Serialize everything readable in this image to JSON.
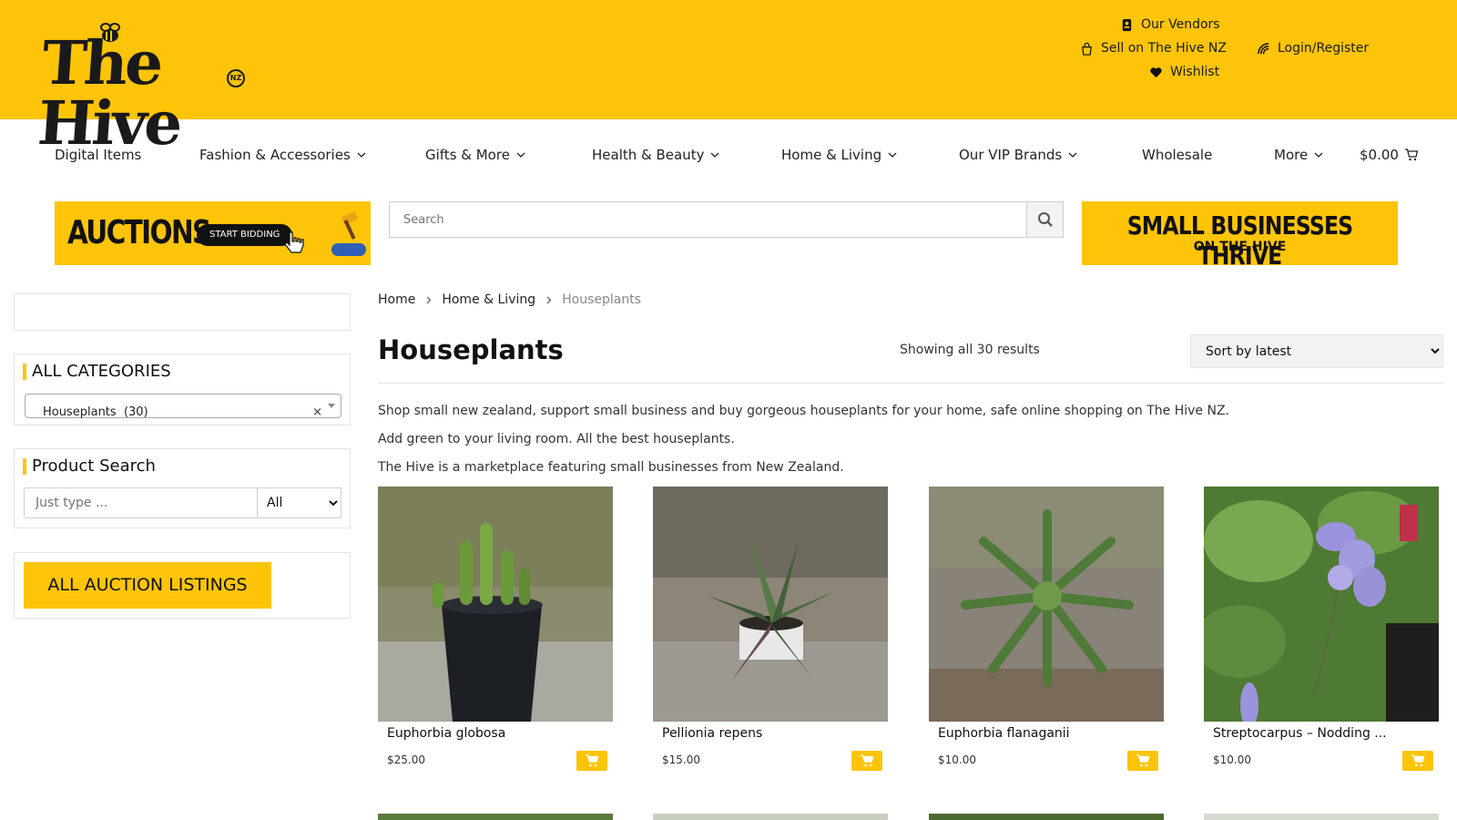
{
  "header": {
    "logo_text": "The Hive",
    "logo_badge": "NZ",
    "links": {
      "vendors": "Our Vendors",
      "sell": "Sell on The Hive NZ",
      "wishlist": "Wishlist",
      "login": "Login/Register"
    }
  },
  "nav": {
    "items": [
      {
        "label": "Digital Items"
      },
      {
        "label": "Fashion & Accessories"
      },
      {
        "label": "Gifts & More"
      },
      {
        "label": "Health & Beauty"
      },
      {
        "label": "Home & Living"
      },
      {
        "label": "Our VIP Brands"
      },
      {
        "label": "Wholesale"
      },
      {
        "label": "More"
      }
    ],
    "cart_total": "$0.00"
  },
  "banners": {
    "auctions": {
      "headline": "AUCTIONS",
      "button": "START BIDDING",
      "badge": "AUCTIONS"
    },
    "thrive": {
      "line1": "SMALL BUSINESSES THRIVE",
      "line2": "ON THE HIVE"
    }
  },
  "search": {
    "placeholder": "Search"
  },
  "sidebar": {
    "categories_title": "ALL CATEGORIES",
    "category_value": "Houseplants  (30)",
    "category_clear": "×",
    "product_search_title": "Product Search",
    "product_search_placeholder": "Just type ...",
    "product_search_scope": "All",
    "auction_button": "ALL AUCTION LISTINGS"
  },
  "breadcrumb": {
    "home": "Home",
    "parent": "Home & Living",
    "current": "Houseplants"
  },
  "listing": {
    "title": "Houseplants",
    "results": "Showing all 30 results",
    "sort": "Sort by latest",
    "description": [
      "Shop small new zealand, support small business and buy gorgeous houseplants for your home, safe online shopping on The Hive NZ.",
      "Add green to your living room. All the best houseplants.",
      "The Hive is a marketplace featuring small businesses from New Zealand."
    ],
    "products": [
      {
        "name": "Euphorbia globosa",
        "price": "$25.00"
      },
      {
        "name": "Pellionia repens",
        "price": "$15.00"
      },
      {
        "name": "Euphorbia flanaganii",
        "price": "$10.00"
      },
      {
        "name": "Streptocarpus – Nodding ...",
        "price": "$10.00"
      }
    ]
  },
  "colors": {
    "brand_yellow": "#fdc408",
    "text_dark": "#111111",
    "muted": "#888888"
  }
}
